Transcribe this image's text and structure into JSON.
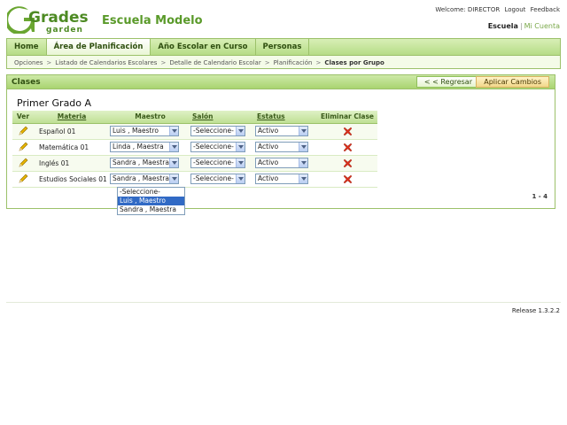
{
  "header": {
    "logo_line1": "Grades",
    "logo_line2": "garden",
    "school_name": "Escuela Modelo",
    "welcome": "Welcome: DIRECTOR",
    "logout": "Logout",
    "feedback": "Feedback",
    "school_link": "Escuela",
    "account_link": "Mi Cuenta",
    "brand_color": "#5a9a2a"
  },
  "nav": {
    "tabs": [
      "Home",
      "Área de Planificación",
      "Año Escolar en Curso",
      "Personas"
    ],
    "active_tab": "Área de Planificación",
    "breadcrumb": [
      "Opciones",
      "Listado de Calendarios Escolares",
      "Detalle de Calendario Escolar",
      "Planificación",
      "Clases por Grupo"
    ]
  },
  "panel": {
    "title": "Clases",
    "back_button": "< < Regresar",
    "apply_button": "Aplicar Cambios",
    "group_title": "Primer Grado A",
    "pager": "1 - 4"
  },
  "table": {
    "headers": {
      "ver": "Ver",
      "materia": "Materia",
      "maestro": "Maestro",
      "salon": "Salón",
      "estatus": "Estatus",
      "eliminar": "Eliminar Clase"
    },
    "rows": [
      {
        "materia": "Español 01",
        "maestro": "Luis , Maestro",
        "salon": "-Seleccione-",
        "estatus": "Activo"
      },
      {
        "materia": "Matemática 01",
        "maestro": "Linda , Maestra",
        "salon": "-Seleccione-",
        "estatus": "Activo"
      },
      {
        "materia": "Inglés 01",
        "maestro": "Sandra , Maestra",
        "salon": "-Seleccione-",
        "estatus": "Activo"
      },
      {
        "materia": "Estudios Sociales 01",
        "maestro": "Sandra , Maestra",
        "salon": "-Seleccione-",
        "estatus": "Activo"
      }
    ]
  },
  "dropdown": {
    "options": [
      "-Seleccione-",
      "Luis , Maestro",
      "Sandra , Maestra"
    ],
    "highlighted": "Luis , Maestro"
  },
  "footer": {
    "release": "Release 1.3.2.2"
  }
}
